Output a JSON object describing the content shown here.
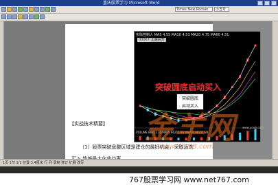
{
  "window": {
    "title": "重庆股票学习 Microsoft Word"
  },
  "toolbar": {
    "style_select": "Times New Roman",
    "size_select": "小五号"
  },
  "chart": {
    "title": "实际控制人 MA5 4.55 MA10 4.53 MA20 4.75 MA60 4.51",
    "stock_code": "000678",
    "status": "止跌回升",
    "banner": "突破圆底启动买入",
    "callout_line1": "突破圆底",
    "callout_line2": "启动买入",
    "volume_label": "VOLUME 86822.31 MAV5 66211.80 MAV10 66211.80",
    "small_watermark": "www.ycwb.com"
  },
  "chart_data": {
    "type": "line",
    "title": "",
    "xlabel": "",
    "ylabel": "",
    "series": [
      {
        "values": [
          4.2,
          4.0,
          3.8,
          3.7,
          3.6,
          3.5,
          3.5,
          3.6,
          3.7,
          3.9,
          4.2,
          4.6,
          5.1,
          5.6,
          6.4,
          7.1
        ]
      }
    ]
  },
  "document": {
    "heading": "【实战技术精要】",
    "para1": "（1）股票突破盘整区域是建仓的最好机会，采取远迭",
    "para2": "买入 能够最大化收益率"
  },
  "watermark": {
    "main": "金羊网",
    "url": "www.YCWB.com"
  },
  "status": {
    "text": "1页 1节 1/1 位置 3.4厘米 行 列 录制 修订 扩展 改写"
  },
  "footer": {
    "text": "767股票学习网 www.net767.com"
  },
  "colors": {
    "banner": "#ff2a2a",
    "watermark": "#eb6e1e",
    "titlebar": "#1b3f8a"
  }
}
